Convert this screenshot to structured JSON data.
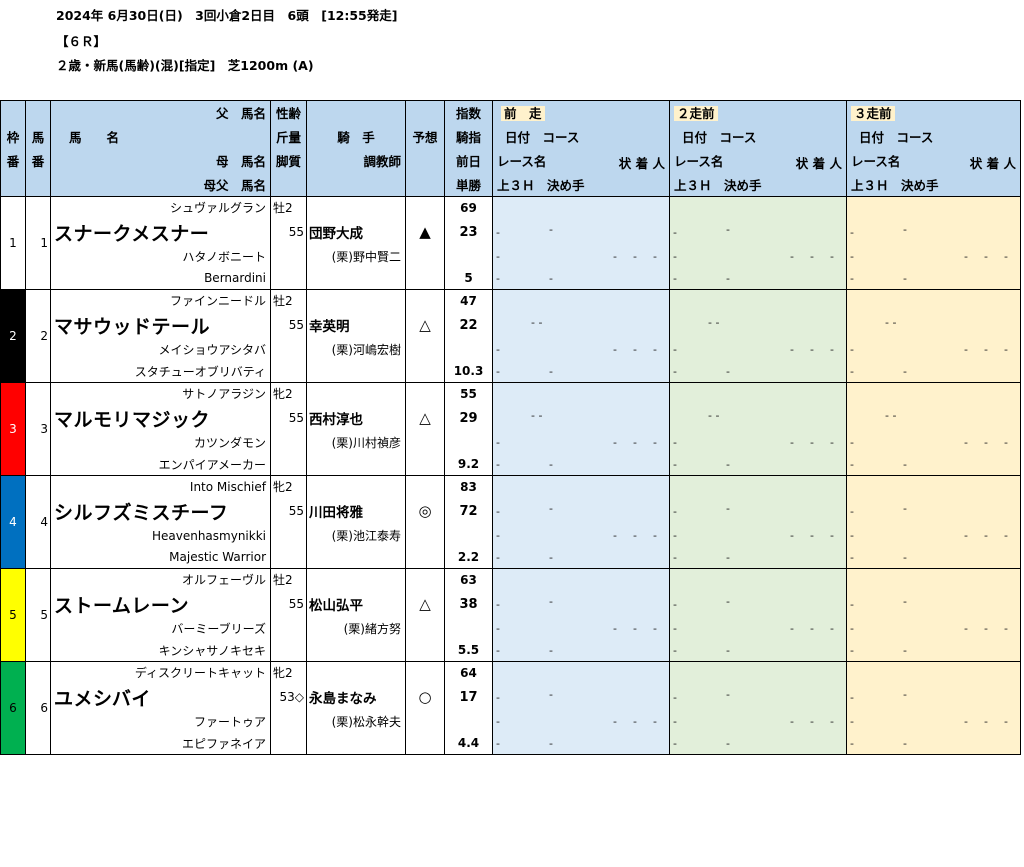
{
  "header": {
    "line1": "2024年 6月30日(日)　3回小倉2日目　6頭　[12:55発走]",
    "line2": "【６Ｒ】",
    "line3": "２歳・新馬(馬齢)(混)[指定]　芝1200m (A)"
  },
  "columns": {
    "waku": [
      "枠",
      "番"
    ],
    "uma": [
      "馬",
      "番"
    ],
    "sire": "父　馬名",
    "name": "馬　　名",
    "dam": "母　馬名",
    "bms": "母父　馬名",
    "sex_age": "性齢",
    "weight": "斤量",
    "style": "脚質",
    "jockey": "騎　手",
    "trainer": "調教師",
    "prediction": "予想",
    "idx1": "指数",
    "idx2": "騎指",
    "idx3": "前日",
    "idx4": "単勝",
    "prev_titles": [
      "前　走",
      "２走前",
      "３走前"
    ],
    "date_course": "日付　コース",
    "race_name": "レース名",
    "status": "状 着 人",
    "last3f": "上３Ｈ　決め手"
  },
  "colors": {
    "header_bg": "#bdd7ee",
    "prev1_bg": "#ddebf7",
    "prev2_bg": "#e2efda",
    "prev3_bg": "#fff2cc"
  },
  "horses": [
    {
      "waku": "1",
      "uma": "1",
      "waku_color": "#ffffff",
      "waku_text": "#000000",
      "sire": "シュヴァルグラン",
      "name": "スナークメスナー",
      "dam": "ハタノボニート",
      "bms": "Bernardini",
      "sex_age": "牡2",
      "weight": "55",
      "jockey": "団野大成",
      "trainer": "(栗)野中賢二",
      "mark": "▲",
      "idx": "69",
      "jockey_idx": "23",
      "prev_day": "",
      "odds": "5"
    },
    {
      "waku": "2",
      "uma": "2",
      "waku_color": "#000000",
      "waku_text": "#ffffff",
      "sire": "ファインニードル",
      "name": "マサウッドテール",
      "dam": "メイショウアシタバ",
      "bms": "スタチューオブリバティ",
      "sex_age": "牡2",
      "weight": "55",
      "jockey": "幸英明",
      "trainer": "(栗)河嶋宏樹",
      "mark": "△",
      "idx": "47",
      "jockey_idx": "22",
      "prev_day": "",
      "odds": "10.3"
    },
    {
      "waku": "3",
      "uma": "3",
      "waku_color": "#ff0000",
      "waku_text": "#ffffff",
      "sire": "サトノアラジン",
      "name": "マルモリマジック",
      "dam": "カツンダモン",
      "bms": "エンパイアメーカー",
      "sex_age": "牝2",
      "weight": "55",
      "jockey": "西村淳也",
      "trainer": "(栗)川村禎彦",
      "mark": "△",
      "idx": "55",
      "jockey_idx": "29",
      "prev_day": "",
      "odds": "9.2"
    },
    {
      "waku": "4",
      "uma": "4",
      "waku_color": "#0070c0",
      "waku_text": "#ffffff",
      "sire": "Into Mischief",
      "name": "シルフズミスチーフ",
      "dam": "Heavenhasmynikki",
      "bms": "Majestic Warrior",
      "sex_age": "牝2",
      "weight": "55",
      "jockey": "川田将雅",
      "trainer": "(栗)池江泰寿",
      "mark": "◎",
      "idx": "83",
      "jockey_idx": "72",
      "prev_day": "",
      "odds": "2.2"
    },
    {
      "waku": "5",
      "uma": "5",
      "waku_color": "#ffff00",
      "waku_text": "#000000",
      "sire": "オルフェーヴル",
      "name": "ストームレーン",
      "dam": "バーミーブリーズ",
      "bms": "キンシャサノキセキ",
      "sex_age": "牡2",
      "weight": "55",
      "jockey": "松山弘平",
      "trainer": "(栗)緒方努",
      "mark": "△",
      "idx": "63",
      "jockey_idx": "38",
      "prev_day": "",
      "odds": "5.5"
    },
    {
      "waku": "6",
      "uma": "6",
      "waku_color": "#00b050",
      "waku_text": "#000000",
      "sire": "ディスクリートキャット",
      "name": "ユメシバイ",
      "dam": "ファートゥア",
      "bms": "エピファネイア",
      "sex_age": "牝2",
      "weight": "53◇",
      "jockey": "永島まなみ",
      "trainer": "(栗)松永幹夫",
      "mark": "○",
      "idx": "64",
      "jockey_idx": "17",
      "prev_day": "",
      "odds": "4.4"
    }
  ],
  "prev_cells": {
    "dash": "-",
    "dash_double": "- -"
  }
}
